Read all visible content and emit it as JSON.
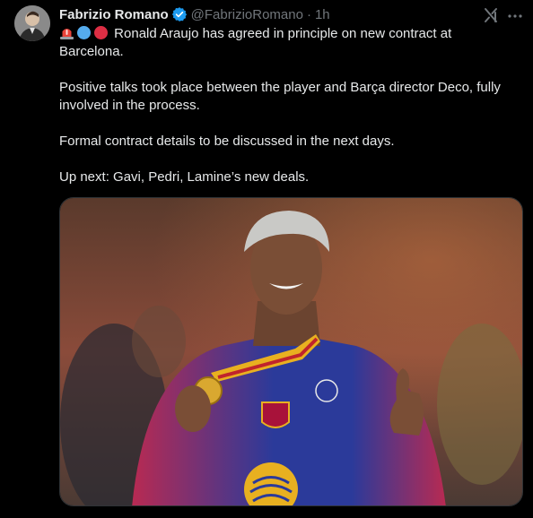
{
  "tweet": {
    "author_name": "Fabrizio Romano",
    "handle": "@FabrizioRomano",
    "separator": "·",
    "time": "1h",
    "verified": true,
    "text_line1": "Ronald Araujo has agreed in principle on new contract at",
    "text_line1b": "Barcelona.",
    "text_line2a": "Positive talks took place between the player and Barça director Deco, fully",
    "text_line2b": "involved in the process.",
    "text_line3": "Formal contract details to be discussed in the next days.",
    "text_line4": "Up next: Gavi, Pedri, Lamine’s new deals."
  },
  "icons": {
    "verified": "verified-badge-icon",
    "grok": "grok-icon",
    "more": "more-options-icon",
    "emoji1": "siren-emoji",
    "emoji2": "blue-circle-emoji",
    "emoji3": "red-circle-emoji"
  },
  "colors": {
    "background": "#000000",
    "text": "#e7e9ea",
    "secondary": "#71767b",
    "verified_blue": "#1d9bf0",
    "border": "#2f3336"
  }
}
